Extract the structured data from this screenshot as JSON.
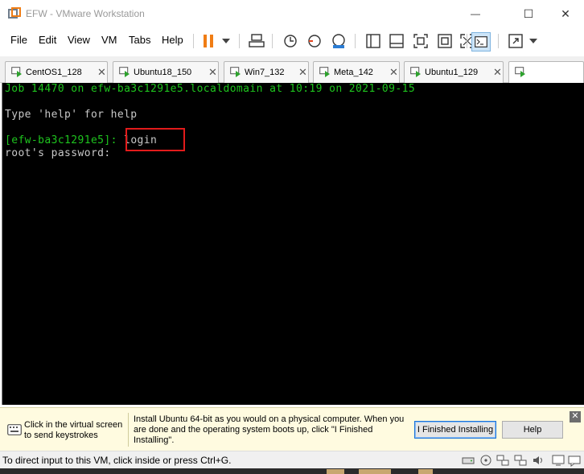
{
  "window": {
    "title": "EFW - VMware Workstation",
    "minimize_glyph": "—",
    "maximize_glyph": "☐",
    "close_glyph": "✕"
  },
  "menu": {
    "items": [
      "File",
      "Edit",
      "View",
      "VM",
      "Tabs",
      "Help"
    ]
  },
  "toolbar": {
    "icons": [
      "pause-icon",
      "dropdown-arrow-icon",
      "send-ctrl-alt-del-icon",
      "snapshot-icon",
      "revert-snapshot-icon",
      "snapshot-manager-icon",
      "library-icon",
      "thumbnail-icon",
      "fullscreen-icon",
      "unity-icon",
      "autofit-icon",
      "console-view-icon",
      "stretch-icon",
      "dropdown-arrow-icon"
    ],
    "accent_color": "#f07d14"
  },
  "tabs": [
    {
      "label": "CentOS1_128",
      "close": "✕"
    },
    {
      "label": "Ubuntu18_150",
      "close": "✕"
    },
    {
      "label": "Win7_132",
      "close": "✕"
    },
    {
      "label": "Meta_142",
      "close": "✕"
    },
    {
      "label": "Ubuntu1_129",
      "close": "✕"
    }
  ],
  "console": {
    "line1": "Job 14470 on efw-ba3c1291e5.localdomain at 10:19 on 2021-09-15",
    "line2": "Type 'help' for help",
    "prompt": "[efw-ba3c1291e5]:",
    "command": "login",
    "line4": "root's password:",
    "text_green": "#1ec41e",
    "text_white": "#c8c8c8",
    "highlight_color": "#e21b1b"
  },
  "hint": {
    "left_text": "Click in the virtual screen to send keystrokes",
    "message": "Install Ubuntu 64-bit as you would on a physical computer. When you are done and the operating system boots up, click \"I Finished Installing\".",
    "finished_button": "I Finished Installing",
    "help_button": "Help",
    "close_glyph": "✕"
  },
  "status": {
    "text": "To direct input to this VM, click inside or press Ctrl+G.",
    "icons": [
      "hard-disk-icon",
      "cd-dvd-icon",
      "network-adapter-icon",
      "usb-controller-icon",
      "sound-card-icon",
      "display-icon",
      "message-log-icon"
    ]
  }
}
